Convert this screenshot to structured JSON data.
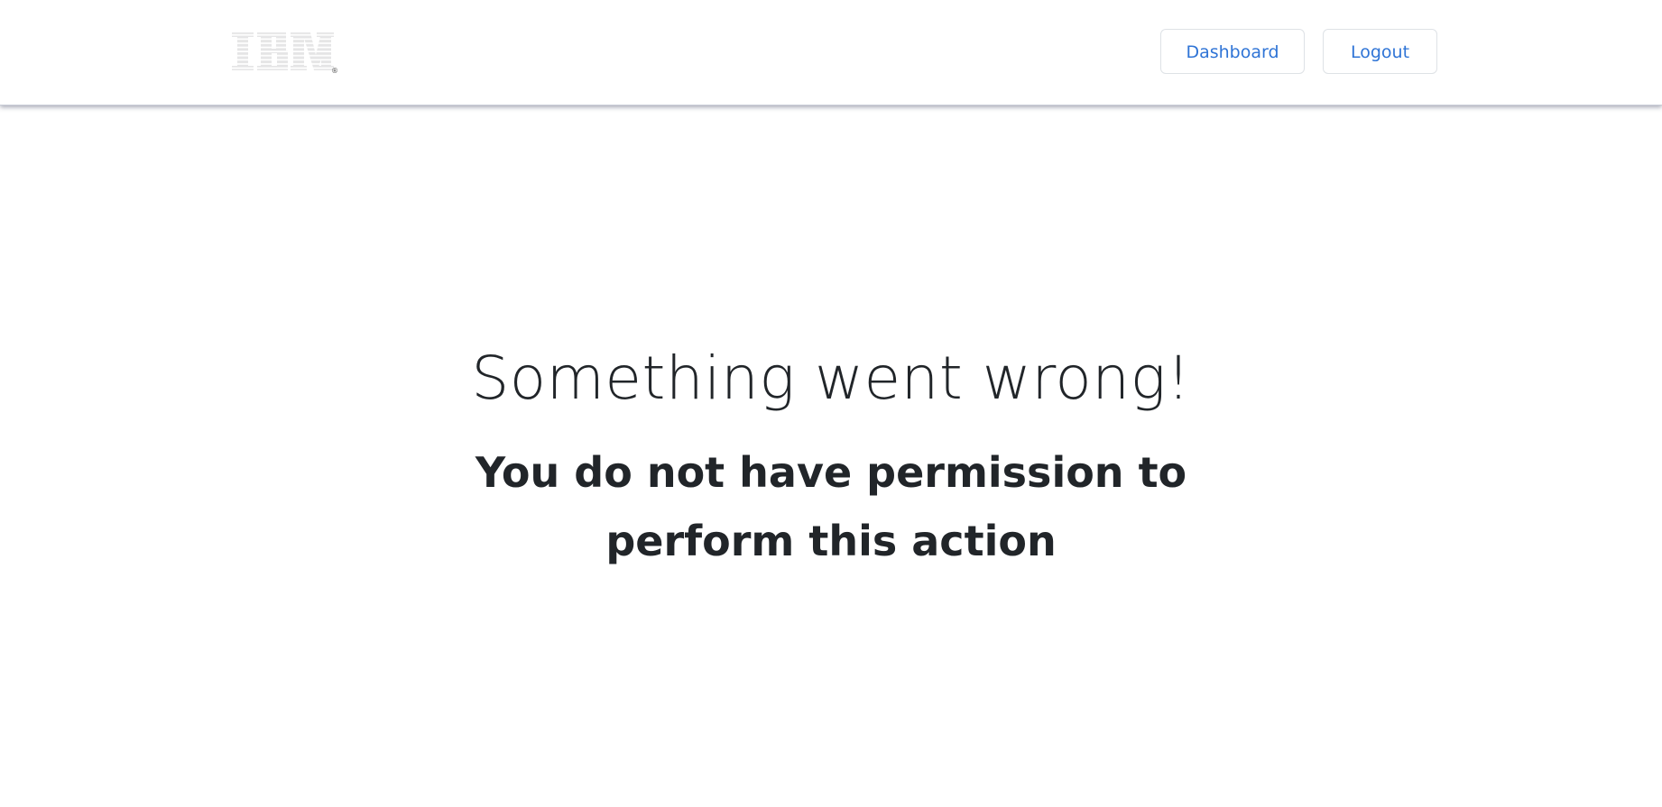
{
  "header": {
    "logo": {
      "text": "IBM",
      "icon": "ibm-striped-logo",
      "registered_mark": "®"
    },
    "buttons": {
      "dashboard_label": "Dashboard",
      "logout_label": "Logout"
    }
  },
  "main": {
    "title": "Something went wrong!",
    "message": "You do not have permission to perform this action"
  },
  "colors": {
    "link_blue": "#2f74d6",
    "text_dark": "#212529",
    "button_border": "#dee2e6"
  }
}
